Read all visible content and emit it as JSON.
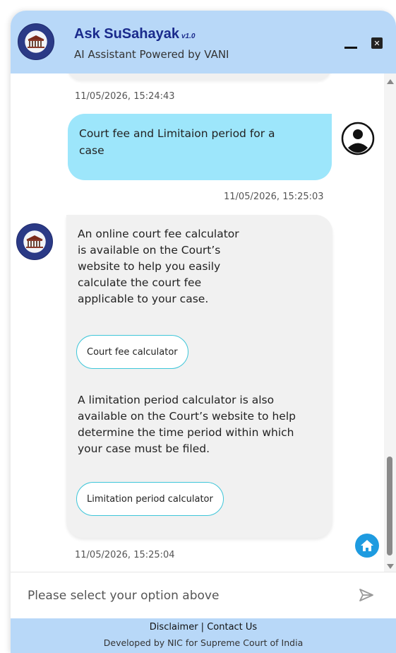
{
  "header": {
    "title": "Ask SuSahayak",
    "version": "v1.0",
    "subtitle": "AI Assistant Powered by VANI"
  },
  "chat": {
    "messages": [
      {
        "sender": "bot",
        "timestamp": "11/05/2026, 15:24:43"
      },
      {
        "sender": "user",
        "text": "Court fee and Limitaion period for a case",
        "timestamp": "11/05/2026, 15:25:03"
      },
      {
        "sender": "bot",
        "text1": "An online court fee calculator is available on the Court’s website to help you easily calculate the court fee applicable to your case.",
        "option1": "Court fee calculator",
        "text2": "A limitation period calculator is also available on the Court’s website to help determine the time period within which your case must be filed.",
        "option2": "Limitation period calculator",
        "timestamp": "11/05/2026, 15:25:04"
      }
    ]
  },
  "input": {
    "placeholder": "Please select your option above"
  },
  "footer": {
    "disclaimer": "Disclaimer",
    "separator": " | ",
    "contact": "Contact Us",
    "credit": "Developed by NIC for Supreme Court of India"
  },
  "colors": {
    "header_bg": "#b8d8f8",
    "title": "#1a2a8c",
    "user_bubble": "#9de6fb",
    "bot_bubble": "#f1f1f1",
    "option_border": "#3ec6d9",
    "home_button": "#1e9be0"
  },
  "icons": {
    "logo": "supreme-court-emblem-icon",
    "minimize": "minimize-icon",
    "close": "close-icon",
    "user": "user-avatar-icon",
    "home": "home-icon",
    "send": "send-icon"
  }
}
